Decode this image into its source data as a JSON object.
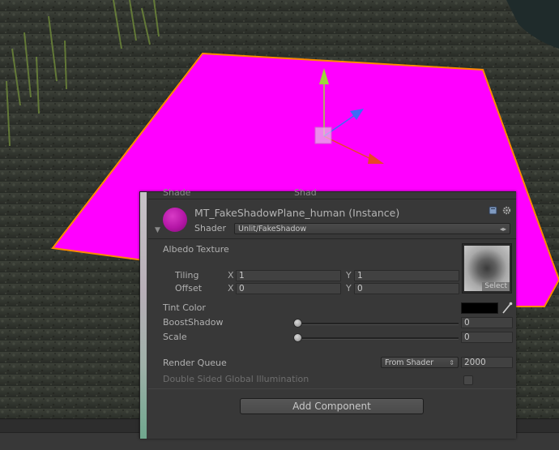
{
  "scene": {
    "plane_color": "#ff00ff",
    "outline_color": "#ff8a00",
    "gizmo_colors": {
      "y": "#9cd63c",
      "x": "#e8462a",
      "z": "#3f6bf5"
    }
  },
  "inspector": {
    "cutoff_left": "Shade",
    "cutoff_right": "Shad",
    "material_title": "MT_FakeShadowPlane_human (Instance)",
    "shader_label": "Shader",
    "shader_value": "Unlit/FakeShadow",
    "header_icons": [
      "book-help-icon",
      "gear-icon"
    ],
    "albedo_label": "Albedo Texture",
    "texture_select": "Select",
    "tiling": {
      "label": "Tiling",
      "x_axis": "X",
      "x": "1",
      "y_axis": "Y",
      "y": "1"
    },
    "offset": {
      "label": "Offset",
      "x_axis": "X",
      "x": "0",
      "y_axis": "Y",
      "y": "0"
    },
    "tint_color": {
      "label": "Tint Color",
      "value": "#000000"
    },
    "boost_shadow": {
      "label": "BoostShadow",
      "value": "0",
      "slider_fraction": 0
    },
    "scale": {
      "label": "Scale",
      "value": "0",
      "slider_fraction": 0
    },
    "render_queue": {
      "label": "Render Queue",
      "mode": "From Shader",
      "value": "2000"
    },
    "double_sided_gi": {
      "label": "Double Sided Global Illumination",
      "checked": false
    },
    "add_component": "Add Component"
  }
}
